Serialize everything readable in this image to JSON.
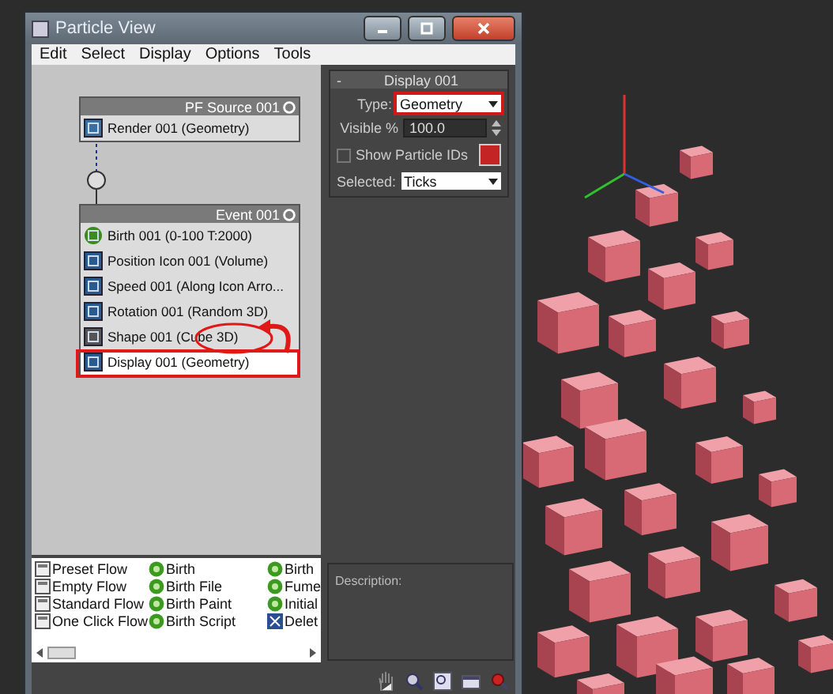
{
  "window": {
    "title": "Particle View"
  },
  "menu": [
    "Edit",
    "Select",
    "Display",
    "Options",
    "Tools"
  ],
  "graph": {
    "source": {
      "title": "PF Source 001",
      "operators": [
        {
          "label": "Render 001 (Geometry)",
          "kind": "render",
          "selected": false
        }
      ]
    },
    "event": {
      "title": "Event 001",
      "operators": [
        {
          "label": "Birth 001 (0-100 T:2000)",
          "kind": "birth",
          "selected": false
        },
        {
          "label": "Position Icon 001 (Volume)",
          "kind": "position",
          "selected": false
        },
        {
          "label": "Speed 001 (Along Icon Arro...",
          "kind": "speed",
          "selected": false
        },
        {
          "label": "Rotation 001 (Random 3D)",
          "kind": "rotation",
          "selected": false
        },
        {
          "label": "Shape 001 (Cube 3D)",
          "kind": "shape",
          "selected": false
        },
        {
          "label": "Display 001 (Geometry)",
          "kind": "display",
          "selected": true
        }
      ]
    }
  },
  "rollout": {
    "title": "Display 001",
    "collapse": "-",
    "type_label": "Type:",
    "type_value": "Geometry",
    "visible_label": "Visible %",
    "visible_value": "100.0",
    "show_ids": {
      "label": "Show Particle IDs",
      "checked": false
    },
    "color": "#c42424",
    "selected_label": "Selected:",
    "selected_value": "Ticks"
  },
  "depot": [
    {
      "label": "Preset Flow",
      "kind": "flow"
    },
    {
      "label": "Birth",
      "kind": "birth"
    },
    {
      "label": "Birth",
      "kind": "birth"
    },
    {
      "label": "Empty Flow",
      "kind": "flow"
    },
    {
      "label": "Birth File",
      "kind": "birth"
    },
    {
      "label": "Fume",
      "kind": "birth"
    },
    {
      "label": "Standard Flow",
      "kind": "flow"
    },
    {
      "label": "Birth Paint",
      "kind": "birth"
    },
    {
      "label": "Initial",
      "kind": "birth"
    },
    {
      "label": "One Click Flow",
      "kind": "flow"
    },
    {
      "label": "Birth Script",
      "kind": "birth"
    },
    {
      "label": "Delet",
      "kind": "delete"
    }
  ],
  "description": {
    "label": "Description:"
  }
}
